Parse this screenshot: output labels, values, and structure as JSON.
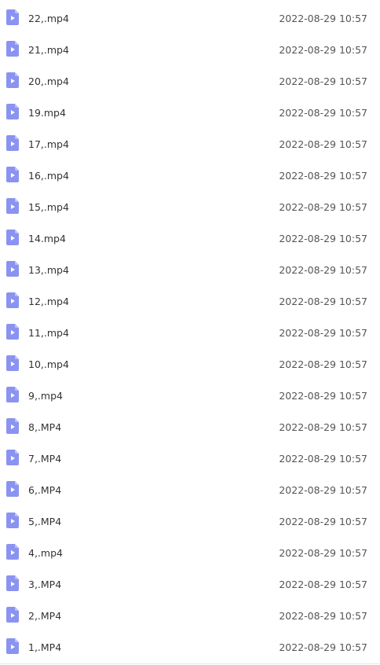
{
  "icon": {
    "name": "video-file-icon",
    "color": "#8b93f0",
    "fold_color": "#b9beff",
    "play_color": "#ffffff"
  },
  "files": [
    {
      "name": "22,.mp4",
      "modified": "2022-08-29 10:57"
    },
    {
      "name": "21,.mp4",
      "modified": "2022-08-29 10:57"
    },
    {
      "name": "20,.mp4",
      "modified": "2022-08-29 10:57"
    },
    {
      "name": "19.mp4",
      "modified": "2022-08-29 10:57"
    },
    {
      "name": "17,.mp4",
      "modified": "2022-08-29 10:57"
    },
    {
      "name": "16,.mp4",
      "modified": "2022-08-29 10:57"
    },
    {
      "name": "15,.mp4",
      "modified": "2022-08-29 10:57"
    },
    {
      "name": "14.mp4",
      "modified": "2022-08-29 10:57"
    },
    {
      "name": "13,.mp4",
      "modified": "2022-08-29 10:57"
    },
    {
      "name": "12,.mp4",
      "modified": "2022-08-29 10:57"
    },
    {
      "name": "11,.mp4",
      "modified": "2022-08-29 10:57"
    },
    {
      "name": "10,.mp4",
      "modified": "2022-08-29 10:57"
    },
    {
      "name": "9,.mp4",
      "modified": "2022-08-29 10:57"
    },
    {
      "name": "8,.MP4",
      "modified": "2022-08-29 10:57"
    },
    {
      "name": "7,.MP4",
      "modified": "2022-08-29 10:57"
    },
    {
      "name": "6,.MP4",
      "modified": "2022-08-29 10:57"
    },
    {
      "name": "5,.MP4",
      "modified": "2022-08-29 10:57"
    },
    {
      "name": "4,.mp4",
      "modified": "2022-08-29 10:57"
    },
    {
      "name": "3,.MP4",
      "modified": "2022-08-29 10:57"
    },
    {
      "name": "2,.MP4",
      "modified": "2022-08-29 10:57"
    },
    {
      "name": "1,.MP4",
      "modified": "2022-08-29 10:57"
    }
  ]
}
